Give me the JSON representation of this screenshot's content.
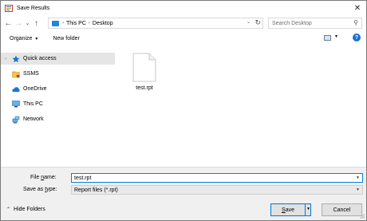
{
  "window": {
    "title": "Save Results",
    "close_glyph": "✕"
  },
  "address": {
    "crumbs": [
      "This PC",
      "Desktop"
    ],
    "search_placeholder": "Search Desktop"
  },
  "toolbar": {
    "organize_label": "Organize",
    "new_folder_label": "New folder",
    "help_glyph": "?"
  },
  "nav": {
    "items": [
      {
        "label": "Quick access",
        "icon": "star-icon",
        "selected": true
      },
      {
        "label": "SSMS",
        "icon": "folder-icon"
      },
      {
        "label": "OneDrive",
        "icon": "cloud-icon"
      },
      {
        "label": "This PC",
        "icon": "computer-icon"
      },
      {
        "label": "Network",
        "icon": "network-icon"
      }
    ]
  },
  "files": [
    {
      "name": "test.rpt",
      "icon": "document-icon"
    }
  ],
  "form": {
    "file_name_label_pre": "File ",
    "file_name_label_u": "n",
    "file_name_label_post": "ame:",
    "file_name_value": "test.rpt",
    "save_type_label_pre": "Save as ",
    "save_type_label_u": "t",
    "save_type_label_post": "ype:",
    "save_type_value": "Report files (*.rpt)"
  },
  "footer": {
    "hide_folders_label": "Hide Folders",
    "save_label_u": "S",
    "save_label_post": "ave",
    "cancel_label": "Cancel"
  },
  "colors": {
    "accent": "#0078d7",
    "selection": "#e5e5e5",
    "panel": "#f0f0f0"
  }
}
